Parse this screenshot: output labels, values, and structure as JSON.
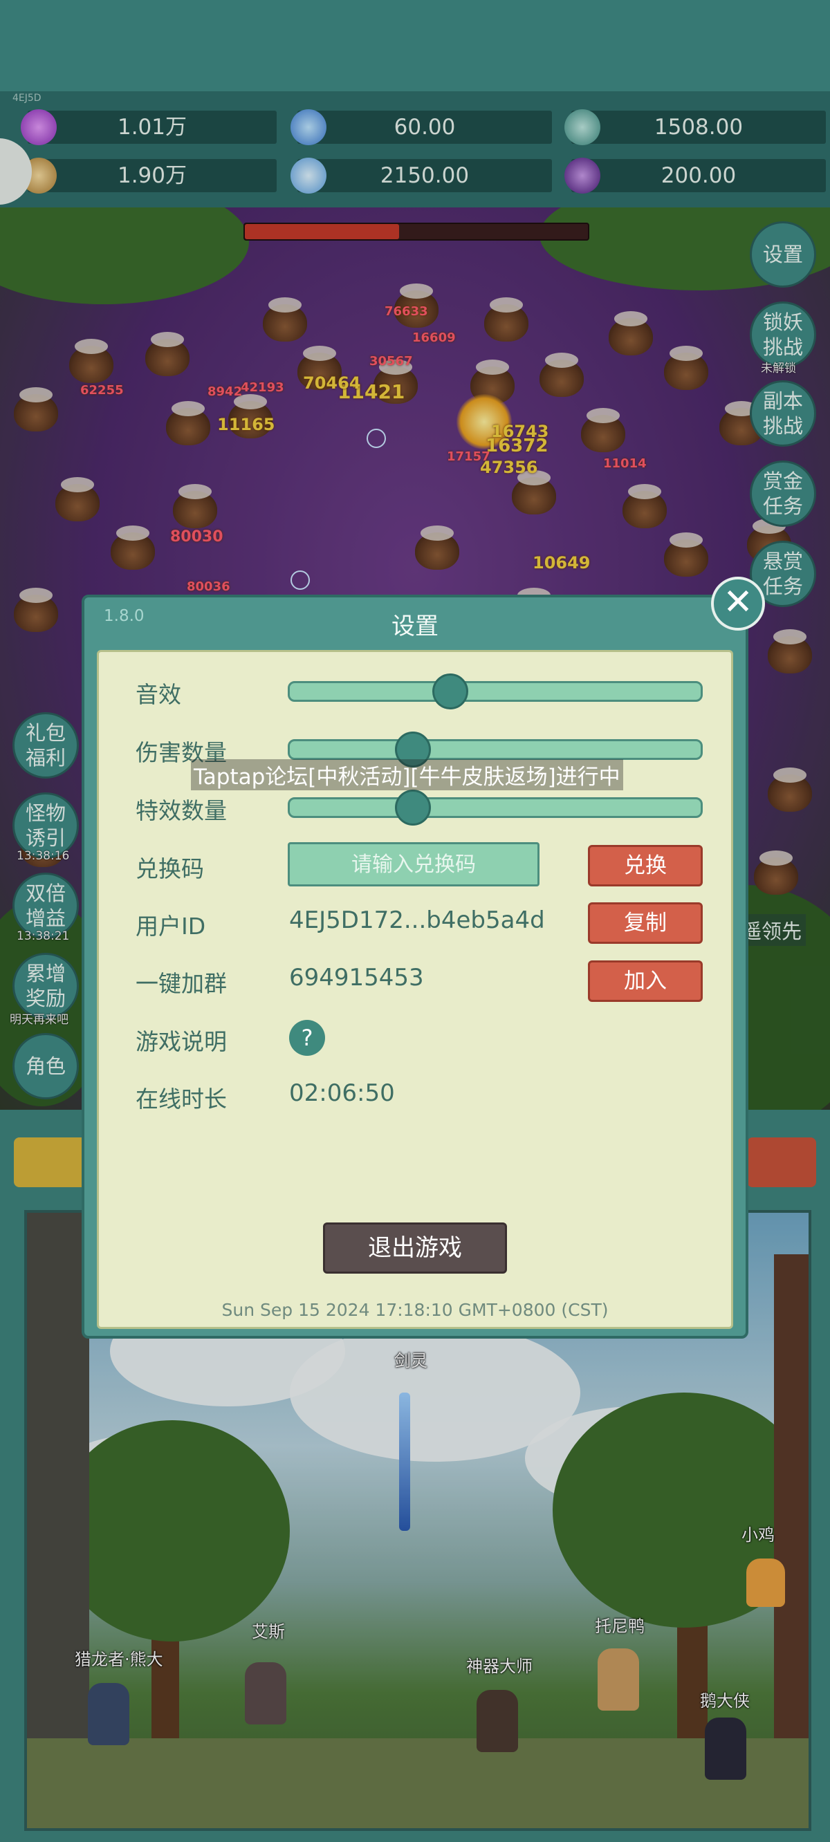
{
  "status_strip": {
    "tiny_id": "4EJ5D"
  },
  "resources": [
    {
      "icon": "purple-gem-icon",
      "value": "1.01万",
      "color": "#b45ed8"
    },
    {
      "icon": "blue-crystal-icon",
      "value": "60.00",
      "color": "#5aa8e8"
    },
    {
      "icon": "green-orb-icon",
      "value": "1508.00",
      "color": "#5ab4a0"
    },
    {
      "icon": "gold-ingot-icon",
      "value": "1.90万",
      "color": "#d8b060"
    },
    {
      "icon": "ice-shard-icon",
      "value": "2150.00",
      "color": "#8ac8f0"
    },
    {
      "icon": "purple-pouch-icon",
      "value": "200.00",
      "color": "#7a3ab0"
    }
  ],
  "boss_hp": {
    "fraction": 0.45
  },
  "damage_numbers": [
    "76633",
    "16609",
    "30567",
    "11421",
    "70464",
    "42193",
    "8942",
    "62255",
    "11165",
    "16743",
    "16372",
    "17157",
    "47356",
    "11014",
    "80030",
    "10649",
    "80036"
  ],
  "right_menu": [
    {
      "label": "设置",
      "sub": ""
    },
    {
      "label": "锁妖挑战",
      "sub": "未解锁"
    },
    {
      "label": "副本挑战",
      "sub": ""
    },
    {
      "label": "赏金任务",
      "sub": ""
    },
    {
      "label": "悬赏任务",
      "sub": ""
    }
  ],
  "left_menu": [
    {
      "label": "礼包福利",
      "sub": ""
    },
    {
      "label": "怪物诱引",
      "sub": "13:38:16"
    },
    {
      "label": "双倍增益",
      "sub": "13:38:21"
    },
    {
      "label": "累增奖励",
      "sub": "明天再来吧"
    },
    {
      "label": "角色",
      "sub": ""
    }
  ],
  "partial_label_right": "遥领先",
  "dialog": {
    "version": "1.8.0",
    "title": "设置",
    "close": "✕",
    "rows": {
      "sound": {
        "label": "音效",
        "level": 0.39
      },
      "damage_count": {
        "label": "伤害数量",
        "level": 0.3
      },
      "effect_count": {
        "label": "特效数量",
        "level": 0.3
      },
      "redeem": {
        "label": "兑换码",
        "placeholder": "请输入兑换码",
        "button": "兑换"
      },
      "user_id": {
        "label": "用户ID",
        "value": "4EJ5D172...b4eb5a4d",
        "button": "复制"
      },
      "join_group": {
        "label": "一键加群",
        "value": "694915453",
        "button": "加入"
      },
      "help": {
        "label": "游戏说明",
        "button": "?"
      },
      "online": {
        "label": "在线时长",
        "value": "02:06:50"
      }
    },
    "exit_button": "退出游戏",
    "timestamp": "Sun Sep 15 2024 17:18:10 GMT+0800 (CST)"
  },
  "toast": "Taptap论坛[中秋活动][牛牛皮肤返场]进行中",
  "heroes": [
    {
      "name": "剑灵"
    },
    {
      "name": "小鸡"
    },
    {
      "name": "艾斯"
    },
    {
      "name": "托尼鸭"
    },
    {
      "name": "猎龙者·熊大"
    },
    {
      "name": "神器大师"
    },
    {
      "name": "鹅大侠"
    }
  ]
}
